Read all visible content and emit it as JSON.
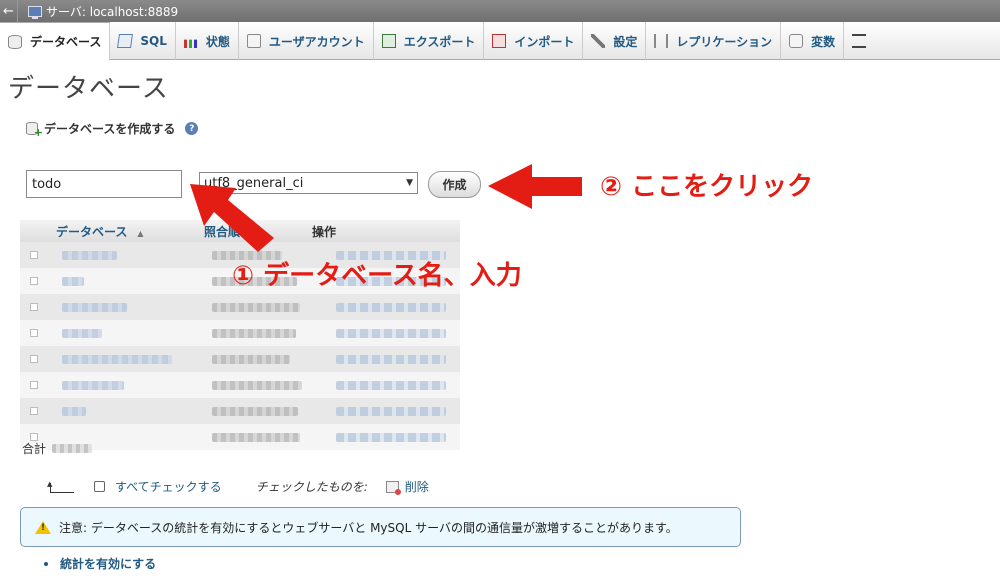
{
  "server_bar": {
    "back_symbol": "←",
    "text": "サーバ:  localhost:8889"
  },
  "tabs": [
    {
      "label": "データベース",
      "icon": "database-icon",
      "active": true
    },
    {
      "label": "SQL",
      "icon": "sql-icon",
      "active": false
    },
    {
      "label": "状態",
      "icon": "status-icon",
      "active": false
    },
    {
      "label": "ユーザアカウント",
      "icon": "users-icon",
      "active": false
    },
    {
      "label": "エクスポート",
      "icon": "export-icon",
      "active": false
    },
    {
      "label": "インポート",
      "icon": "import-icon",
      "active": false
    },
    {
      "label": "設定",
      "icon": "settings-icon",
      "active": false
    },
    {
      "label": "レプリケーション",
      "icon": "replication-icon",
      "active": false
    },
    {
      "label": "変数",
      "icon": "variables-icon",
      "active": false
    }
  ],
  "page_title": "データベース",
  "create_db": {
    "label": "データベースを作成する",
    "help_symbol": "?",
    "name_value": "todo",
    "collation_value": "utf8_general_ci",
    "create_button_label": "作成"
  },
  "db_table": {
    "headers": {
      "database": "データベース",
      "collation": "照合順",
      "operations": "操作"
    },
    "sort_symbol": "▲",
    "row_count": 8,
    "total_label": "合計"
  },
  "bulk": {
    "check_all_label": "すべてチェックする",
    "with_selected_label": "チェックしたものを:",
    "delete_label": "削除"
  },
  "notice": {
    "text": "注意: データベースの統計を有効にするとウェブサーバと MySQL サーバの間の通信量が激増することがあります。"
  },
  "enable_stats_label": "統計を有効にする",
  "annotations": {
    "step1": "① データベース名、入力",
    "step2": "② ここをクリック",
    "color": "#e41d14"
  },
  "colors": {
    "link": "#235a81",
    "notice_bg": "#ebf8fd",
    "notice_border": "#7a9ab8"
  }
}
